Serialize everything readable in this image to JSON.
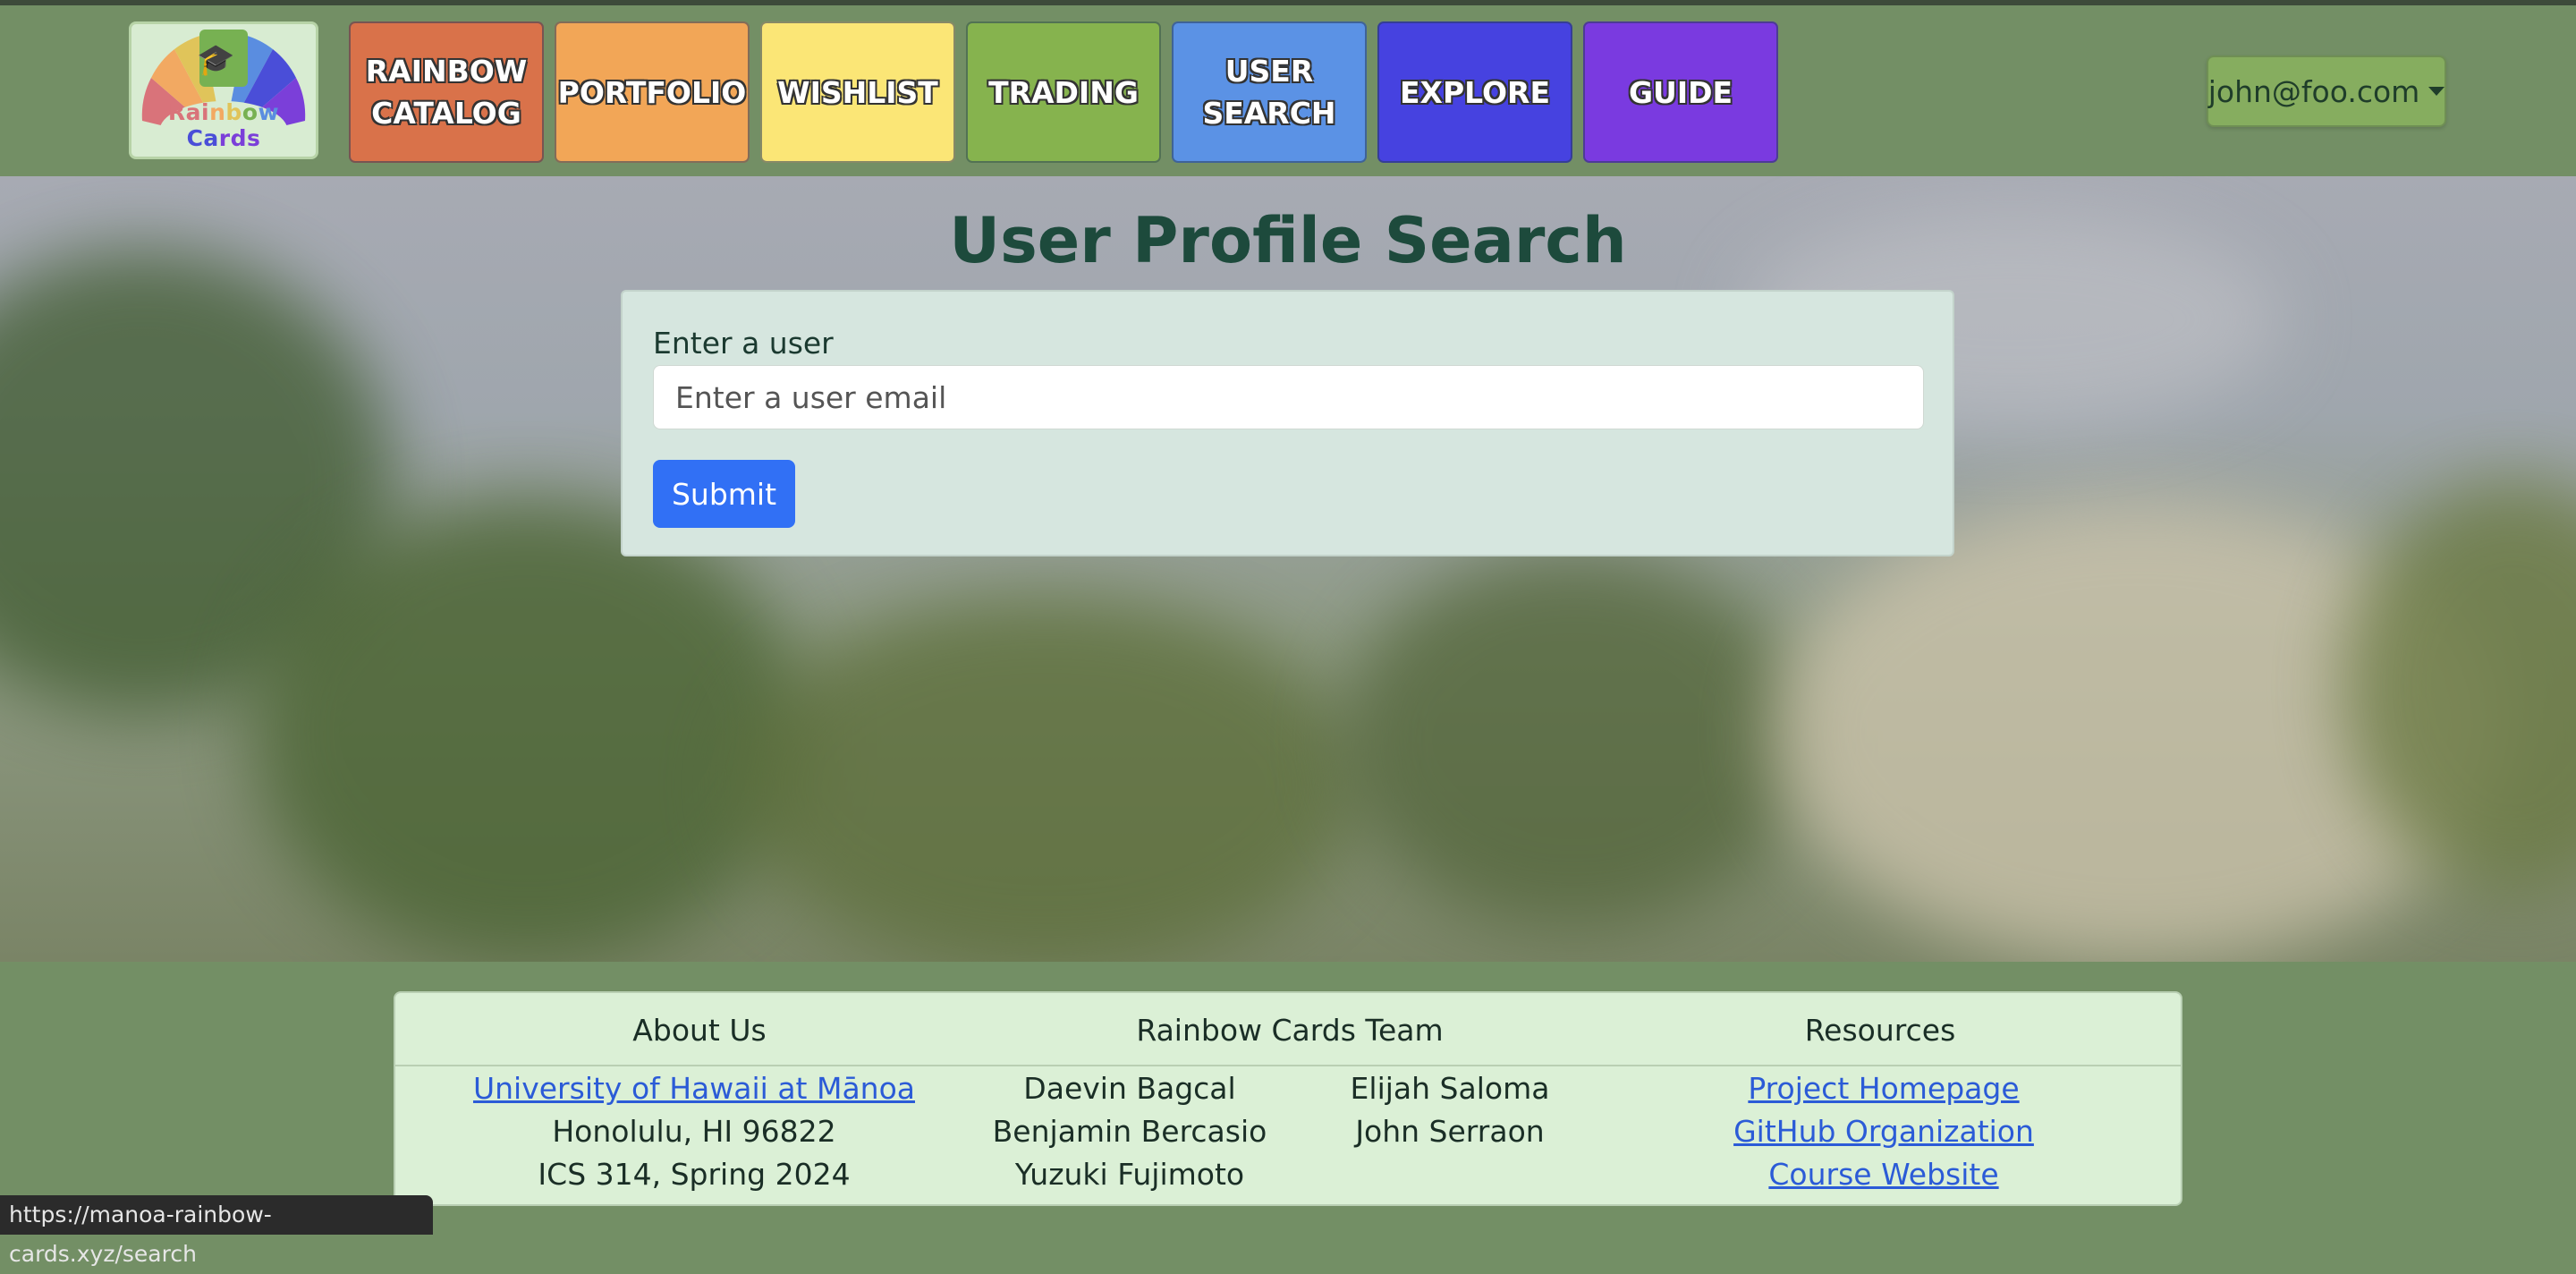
{
  "logo": {
    "text_parts": [
      {
        "t": "Rai",
        "color": "#d9737a"
      },
      {
        "t": "n",
        "color": "#f2a962"
      },
      {
        "t": "b",
        "color": "#e0c45a"
      },
      {
        "t": "o",
        "color": "#77b152"
      },
      {
        "t": "w ",
        "color": "#5a8de0"
      },
      {
        "t": "Ca",
        "color": "#4a4ed8"
      },
      {
        "t": "rds",
        "color": "#7b3fd9"
      }
    ],
    "icon": "graduation-cap-icon"
  },
  "nav": {
    "tiles": [
      {
        "label": "RAINBOW\nCATALOG",
        "color": "#d9724a"
      },
      {
        "label": "PORTFOLIO",
        "color": "#f2a657"
      },
      {
        "label": "WISHLIST",
        "color": "#fbe676"
      },
      {
        "label": "TRADING",
        "color": "#86b34e"
      },
      {
        "label": "USER\nSEARCH",
        "color": "#5b92e5"
      },
      {
        "label": "EXPLORE",
        "color": "#4642e0"
      },
      {
        "label": "GUIDE",
        "color": "#7a3ae0"
      }
    ],
    "user_menu": "john@foo.com"
  },
  "page": {
    "title": "User Profile Search",
    "field_label": "Enter a user",
    "field_placeholder": "Enter a user email",
    "field_value": "",
    "submit_label": "Submit"
  },
  "footer": {
    "about_heading": "About Us",
    "about_link": "University of Hawaii at Mānoa",
    "about_line2": "Honolulu, HI 96822",
    "about_line3": "ICS 314, Spring 2024",
    "team_heading": "Rainbow Cards Team",
    "team_members": [
      "Daevin Bagcal",
      "Benjamin Bercasio",
      "Yuzuki Fujimoto",
      "Elijah Saloma",
      "John Serraon"
    ],
    "resources_heading": "Resources",
    "resources_links": [
      "Project Homepage",
      "GitHub Organization",
      "Course Website"
    ]
  },
  "status_bar_url": "https://manoa-rainbow-cards.xyz/search",
  "colors": {
    "page_bg": "#738f65",
    "submit": "#3170f5",
    "card_bg": "#d6e6df",
    "footer_bg": "#dbf0d6"
  }
}
